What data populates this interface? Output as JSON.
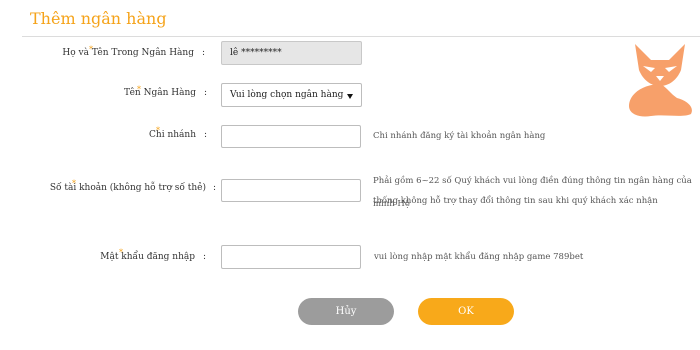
{
  "page": {
    "title": "Thêm ngân hàng"
  },
  "form": {
    "fullname": {
      "label": "Họ và Tên Trong Ngân Hàng",
      "value": "lê *********"
    },
    "bank": {
      "label": "Tên Ngân Hàng",
      "selected": "Vui lòng chọn ngân hàng"
    },
    "branch": {
      "label": "Chi nhánh",
      "value": "",
      "hint": "Chi nhánh đăng ký tài khoản ngân hàng"
    },
    "account": {
      "label": "Số tài khoản (không hỗ trợ số thẻ)",
      "value": "",
      "hint_line1": "Phải gồm 6~22 số Quý khách vui lòng điền đúng thông tin ngân hàng của mình Hệ",
      "hint_line2": "thống không hỗ trợ thay đổi thông tin sau khi quý khách xác nhận"
    },
    "password": {
      "label": "Mật khẩu đăng nhập",
      "value": "",
      "hint": "vui lòng nhập mật khẩu đăng nhập game 789bet"
    },
    "colon": ":",
    "required_mark": "*"
  },
  "buttons": {
    "cancel": "Hủy",
    "ok": "OK"
  },
  "colors": {
    "accent": "#f5a31a",
    "fox": "#f7a06a",
    "cancel": "#9c9c9c",
    "ok": "#f8a91a"
  },
  "icons": {
    "mascot": "fox-icon",
    "dropdown": "caret-down-icon"
  }
}
